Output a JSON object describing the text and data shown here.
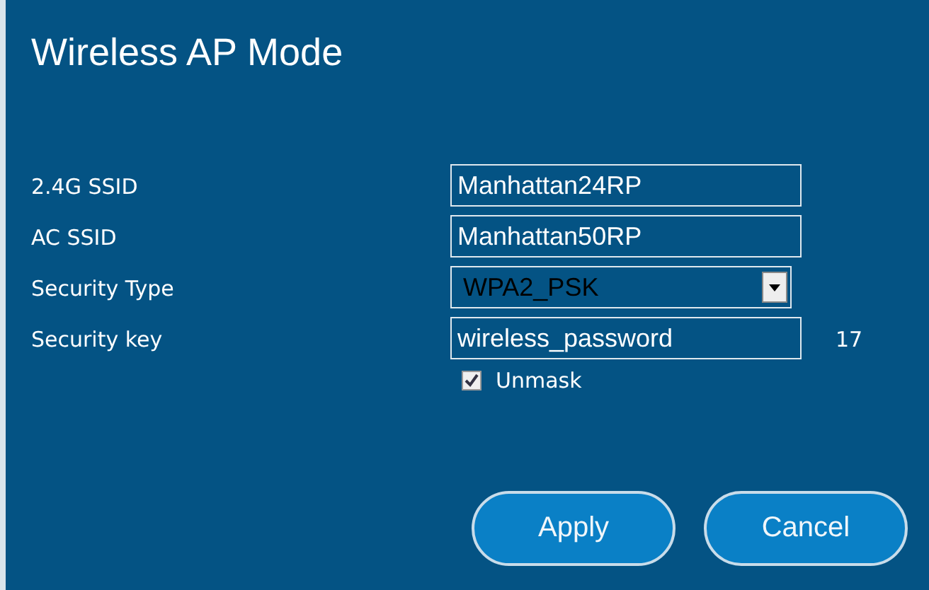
{
  "title": "Wireless AP Mode",
  "fields": [
    {
      "kind": "text",
      "label": "2.4G SSID",
      "value": "Manhattan24RP"
    },
    {
      "kind": "text",
      "label": "AC SSID",
      "value": "Manhattan50RP"
    },
    {
      "kind": "select",
      "label": "Security Type",
      "value": "WPA2_PSK"
    },
    {
      "kind": "text",
      "label": "Security key",
      "value": "wireless_password",
      "count": "17"
    }
  ],
  "unmask": {
    "label": "Unmask",
    "checked": true
  },
  "buttons": [
    "Apply",
    "Cancel"
  ]
}
